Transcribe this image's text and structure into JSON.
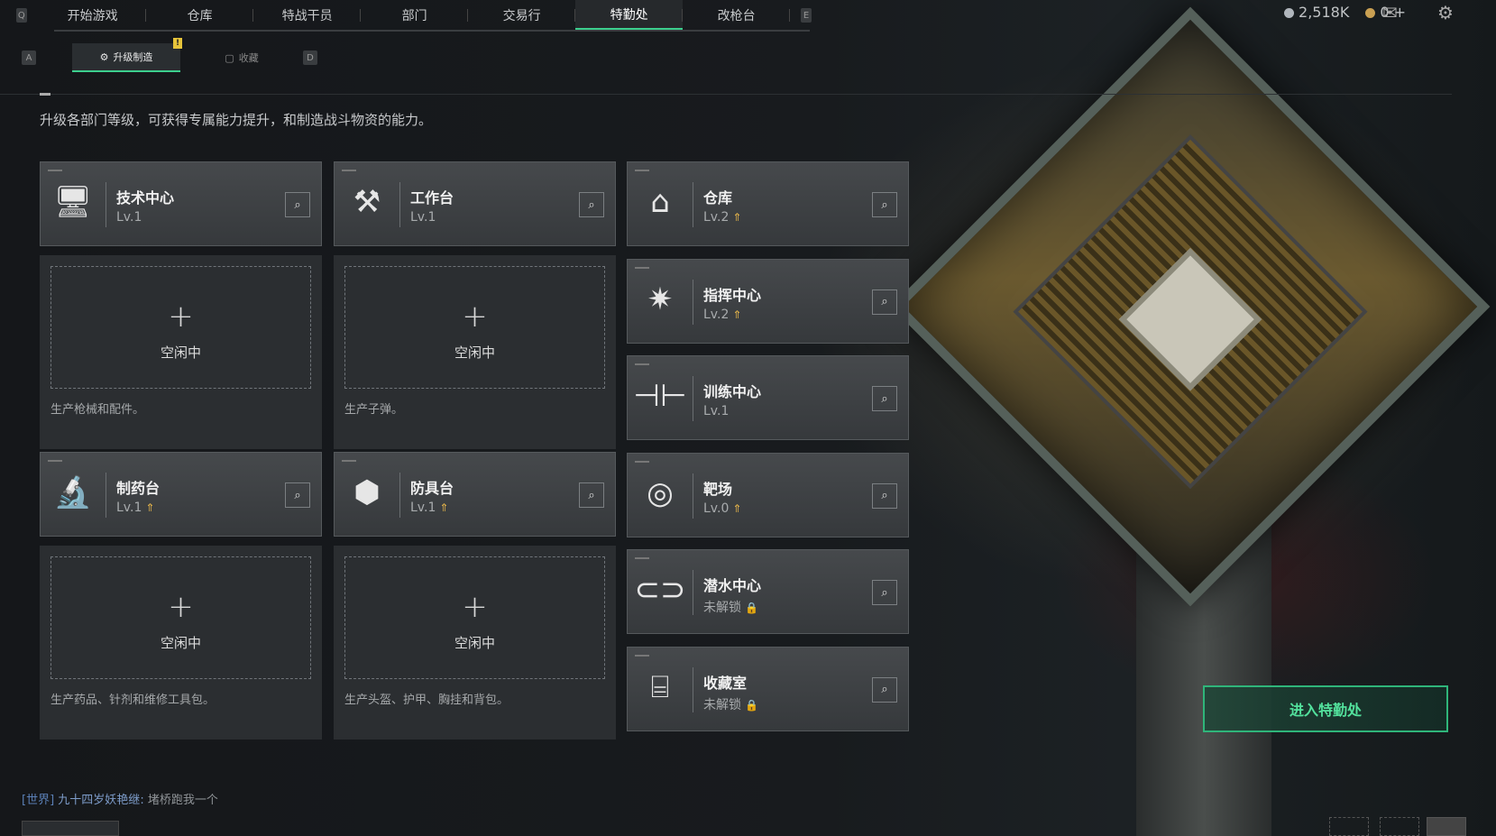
{
  "nav": {
    "key_left": "Q",
    "key_right": "E",
    "tabs": [
      {
        "label": "开始游戏"
      },
      {
        "label": "仓库"
      },
      {
        "label": "特战干员"
      },
      {
        "label": "部门"
      },
      {
        "label": "交易行"
      },
      {
        "label": "特勤处"
      },
      {
        "label": "改枪台"
      }
    ],
    "active_tab": "特勤处"
  },
  "resources": {
    "currency1": "2,518K",
    "currency2": "0",
    "add": "+"
  },
  "subnav": {
    "key_left": "A",
    "key_right": "D",
    "tabs": [
      {
        "label": "升级制造",
        "badge": "!"
      },
      {
        "label": "收藏"
      }
    ]
  },
  "description": "升级各部门等级，可获得专属能力提升，和制造战斗物资的能力。",
  "idle_text": "空闲中",
  "plus": "+",
  "manufacture": [
    {
      "name": "技术中心",
      "level": "Lv.1",
      "upgradable": false,
      "icon": "computer-icon",
      "product": "生产枪械和配件。"
    },
    {
      "name": "工作台",
      "level": "Lv.1",
      "upgradable": false,
      "icon": "tools-icon",
      "product": "生产子弹。"
    },
    {
      "name": "制药台",
      "level": "Lv.1",
      "upgradable": true,
      "icon": "microscope-icon",
      "product": "生产药品、针剂和维修工具包。"
    },
    {
      "name": "防具台",
      "level": "Lv.1",
      "upgradable": true,
      "icon": "armor-hex-icon",
      "product": "生产头盔、护甲、胸挂和背包。"
    }
  ],
  "facilities": [
    {
      "name": "仓库",
      "level": "Lv.2",
      "upgradable": true,
      "locked": false,
      "icon": "warehouse-icon"
    },
    {
      "name": "指挥中心",
      "level": "Lv.2",
      "upgradable": true,
      "locked": false,
      "icon": "command-chip-icon"
    },
    {
      "name": "训练中心",
      "level": "Lv.1",
      "upgradable": false,
      "locked": false,
      "icon": "dumbbell-icon"
    },
    {
      "name": "靶场",
      "level": "Lv.0",
      "upgradable": true,
      "locked": false,
      "icon": "target-icon"
    },
    {
      "name": "潜水中心",
      "level": "未解锁",
      "upgradable": false,
      "locked": true,
      "icon": "diving-mask-icon"
    },
    {
      "name": "收藏室",
      "level": "未解锁",
      "upgradable": false,
      "locked": true,
      "icon": "display-case-icon"
    }
  ],
  "enter_button": "进入特勤处",
  "chat": {
    "channel": "[世界]",
    "sender": "九十四岁妖艳继",
    "message": "堵桥跑我一个"
  },
  "colors": {
    "accent": "#3ccf8e",
    "upgrade": "#e3b34a",
    "badge": "#e7c43a"
  }
}
